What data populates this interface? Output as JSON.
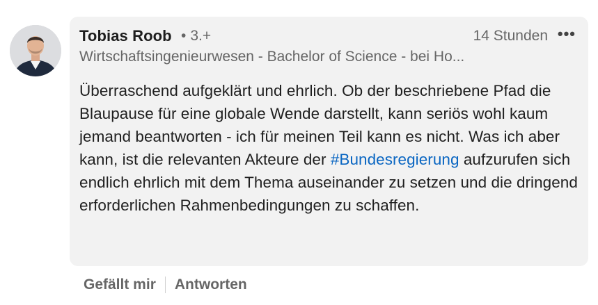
{
  "comment": {
    "author_name": "Tobias Roob",
    "degree_dot": "•",
    "degree": "3.+",
    "time": "14 Stunden",
    "more_label": "•••",
    "headline": "Wirtschaftsingenieurwesen - Bachelor of Science - bei Ho...",
    "text_part1": "Überraschend aufgeklärt und ehrlich. Ob der beschriebene Pfad die Blaupause für eine globale Wende darstellt, kann seriös wohl kaum jemand beantworten - ich für meinen Teil kann es nicht. Was ich aber kann, ist die relevanten Akteure der ",
    "hashtag": "#Bundesregierung",
    "text_part2": " aufzurufen sich endlich ehrlich mit dem Thema auseinander zu setzen und die dringend erforderlichen Rahmenbedingungen zu schaffen."
  },
  "actions": {
    "like_label": "Gefällt mir",
    "reply_label": "Antworten"
  },
  "colors": {
    "bubble_bg": "#f2f2f2",
    "hashtag": "#0a66c2",
    "muted_text": "#666666"
  }
}
